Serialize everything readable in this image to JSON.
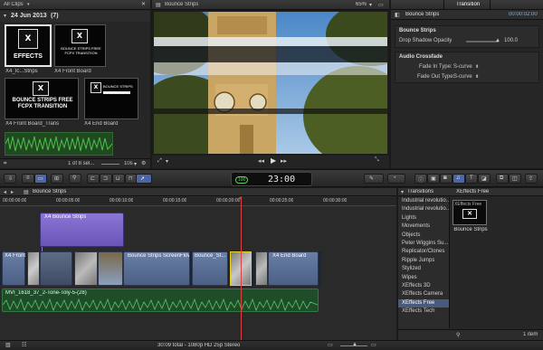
{
  "browser": {
    "library_label": "All Clips",
    "event_date": "24 Jun 2013",
    "event_count": "(7)",
    "clips": [
      {
        "label": "X4_Ic...Strips",
        "logo": "X",
        "caption": "EFFECTS"
      },
      {
        "label": "X4 Front Board",
        "logo": "X",
        "caption": "BOUNCE STRIPS FREE FCPX TRANSITION"
      },
      {
        "label": "X4 Front Board_Trans",
        "logo": "X",
        "caption": "BOUNCE STRIPS FREE FCPX TRANSITION"
      },
      {
        "label": "X4 End Board",
        "logo": "X",
        "caption": "BOUNCE STRIPS"
      }
    ],
    "selection_status": "1 of 8 sel...",
    "zoom_value": "10s"
  },
  "viewer": {
    "title": "Bounce Strips",
    "zoom": "65%",
    "transition_label": "Transition"
  },
  "inspector": {
    "title": "Bounce Strips",
    "timecode": "00:00:02:00",
    "section_main": "Bounce Strips",
    "drop_shadow_label": "Drop Shadow Opacity",
    "drop_shadow_value": "100.0",
    "drop_shadow_level": 1.0,
    "section_crossfade": "Audio Crossfade",
    "fade_in_label": "Fade In Type:",
    "fade_in_value": "S-curve",
    "fade_out_label": "Fade Out Type:",
    "fade_out_value": "S-curve"
  },
  "toolbar": {
    "timecode": "23:00",
    "timecode_prefix": "100"
  },
  "timeline": {
    "project_name": "Bounce Strips",
    "ruler": [
      "00:00:00:00",
      "00:00:05:00",
      "00:00:10:00",
      "00:00:15:00",
      "00:00:20:00",
      "00:00:25:00",
      "00:00:30:00"
    ],
    "connected_clip": "X4 Bounce Strips",
    "primary_clips": [
      "X4 Front",
      "Bounce Strips ScreenFlow",
      "Bounce_St...",
      "X4 End Board"
    ],
    "audio_clip": "MVI_1618_37_2-Tone-Toly-5-(28)",
    "status": "30:09 total - 1080p HD 25p Stereo"
  },
  "transitions_browser": {
    "title": "Transitions",
    "category_header": "XEffects Free",
    "categories": [
      "Industrial revolutio...",
      "Industrial revolutio...",
      "Lights",
      "Movements",
      "Objects",
      "Peter Wiggins Su...",
      "Replicator/Clones",
      "Ripple Jumps",
      "Stylized",
      "Wipes",
      "XEffects 3D",
      "XEffects Camera",
      "XEffects Free",
      "XEffects Tech"
    ],
    "selected_category": "XEffects Free",
    "thumb_caption": "XEffects Free",
    "thumb_label": "Bounce Strips",
    "item_count": "1 item"
  }
}
